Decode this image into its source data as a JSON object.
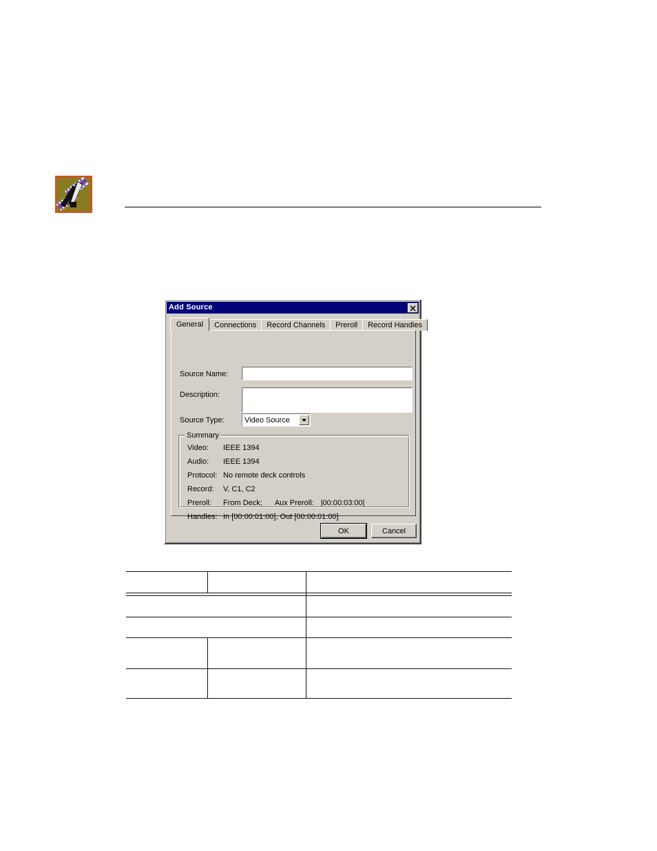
{
  "page": {
    "header_icon": {
      "name": "avid-editing-icon",
      "border_color": "#e24a1a",
      "background_color": "#8a7a22",
      "filmstrip_color": "#7b3fa0",
      "blade_color": "#000000"
    }
  },
  "dialog": {
    "title": "Add Source",
    "titlebar_color": "#00007b",
    "face_color": "#d4d0c8",
    "close_button": {
      "icon": "close-icon",
      "label": "Close"
    },
    "tabs": [
      {
        "label": "General",
        "active": true
      },
      {
        "label": "Connections",
        "active": false
      },
      {
        "label": "Record Channels",
        "active": false
      },
      {
        "label": "Preroll",
        "active": false
      },
      {
        "label": "Record Handles",
        "active": false
      }
    ],
    "general_tab": {
      "source_name": {
        "label_pre": "S",
        "label_mnemonic": "",
        "label": "Source Name:",
        "value": "",
        "placeholder": ""
      },
      "description": {
        "label": "Description:",
        "value": "",
        "placeholder": ""
      },
      "source_type": {
        "label": "Source Type:",
        "value": "Video Source",
        "options": [
          "Video Source"
        ],
        "arrow_icon": "chevron-down-icon"
      },
      "summary": {
        "group_label": "Summary",
        "rows": [
          {
            "key": "Video:",
            "value": "IEEE 1394"
          },
          {
            "key": "Audio:",
            "value": "IEEE 1394"
          },
          {
            "key": "Protocol:",
            "value": "No remote deck controls"
          },
          {
            "key": "Record:",
            "value": "V, C1, C2"
          },
          {
            "key": "Preroll:",
            "value": "From Deck;",
            "value2": "Aux Preroll:",
            "value3": "|00:00:03:00|"
          },
          {
            "key": "Handles:",
            "value": "In  [00:00:01:00], Out [00:00:01:00]"
          }
        ]
      }
    },
    "buttons": {
      "ok": "OK",
      "cancel": "Cancel"
    }
  },
  "table": {
    "columns": 3,
    "rows": [
      {
        "cells": [
          "",
          "",
          ""
        ]
      },
      {
        "cells": [
          "",
          "",
          ""
        ]
      },
      {
        "cells": [
          "",
          "",
          ""
        ]
      },
      {
        "cells": [
          "",
          "",
          ""
        ]
      },
      {
        "cells": [
          "",
          "",
          ""
        ]
      }
    ]
  }
}
